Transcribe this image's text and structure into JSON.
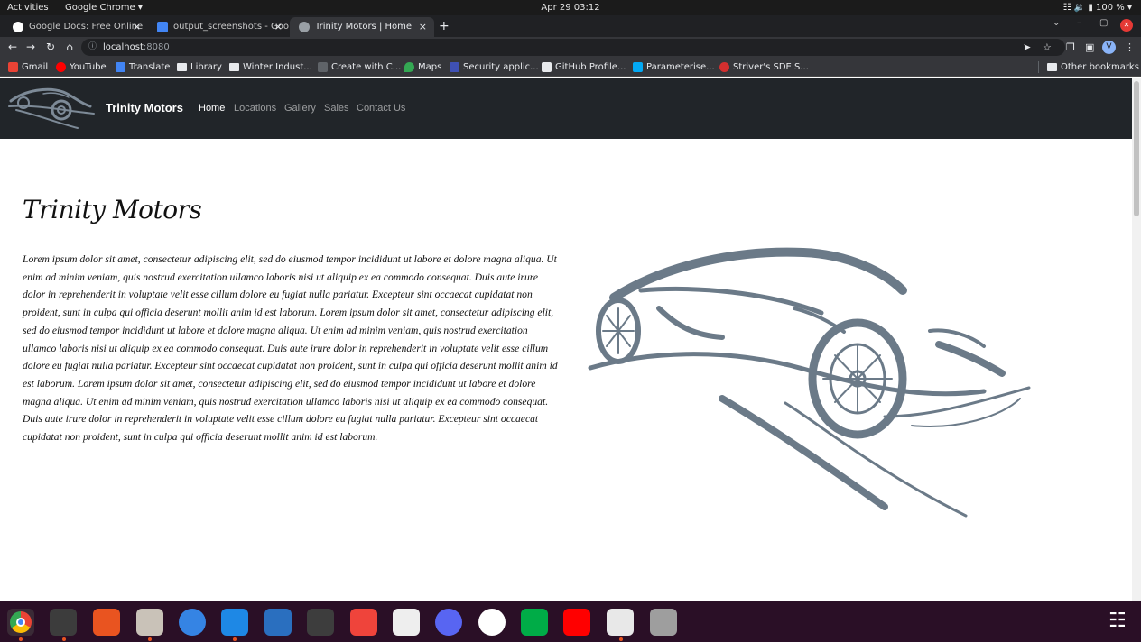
{
  "system_bar": {
    "activities": "Activities",
    "app_menu": "Google Chrome ▾",
    "clock": "Apr 29  03:12",
    "status": "☷ 🔉 ▮ 100 % ▾"
  },
  "browser": {
    "tabs": [
      {
        "label": "Google Docs: Free Online",
        "close": "×"
      },
      {
        "label": "output_screenshots - Goo",
        "close": "×"
      },
      {
        "label": "Trinity Motors | Home",
        "close": "×"
      }
    ],
    "new_tab": "+",
    "window_controls": {
      "menu": "⌄",
      "minimize": "–",
      "restore": "▢",
      "close": "✕"
    },
    "nav": {
      "back": "←",
      "forward": "→",
      "reload": "↻",
      "home": "⌂"
    },
    "url": {
      "host": "localhost",
      "port": ":8080",
      "info_icon": "ⓘ"
    },
    "toolbar_right": {
      "send": "➤",
      "star": "☆",
      "extensions": "❒",
      "sidebar": "▣",
      "profile_initial": "V",
      "menu": "⋮"
    },
    "bookmarks": [
      {
        "label": "Gmail",
        "color": "#ea4335"
      },
      {
        "label": "YouTube",
        "color": "#ff0000"
      },
      {
        "label": "Translate",
        "color": "#4285f4"
      },
      {
        "label": "Library",
        "color": "folder"
      },
      {
        "label": "Winter Indust...",
        "color": "folder"
      },
      {
        "label": "Create with C...",
        "color": "#5f6368"
      },
      {
        "label": "Maps",
        "color": "#34a853"
      },
      {
        "label": "Security applic...",
        "color": "#3f51b5"
      },
      {
        "label": "GitHub Profile...",
        "color": "#e8eaed"
      },
      {
        "label": "Parameterise...",
        "color": "#03a9f4"
      },
      {
        "label": "Striver's SDE S...",
        "color": "#d32f2f"
      }
    ],
    "other_bookmarks": "Other bookmarks"
  },
  "site": {
    "brand": "Trinity Motors",
    "nav": [
      "Home",
      "Locations",
      "Gallery",
      "Sales",
      "Contact Us"
    ],
    "heading": "Trinity Motors",
    "body": "Lorem ipsum dolor sit amet, consectetur adipiscing elit, sed do eiusmod tempor incididunt ut labore et dolore magna aliqua. Ut enim ad minim veniam, quis nostrud exercitation ullamco laboris nisi ut aliquip ex ea commodo consequat. Duis aute irure dolor in reprehenderit in voluptate velit esse cillum dolore eu fugiat nulla pariatur. Excepteur sint occaecat cupidatat non proident, sunt in culpa qui officia deserunt mollit anim id est laborum. Lorem ipsum dolor sit amet, consectetur adipiscing elit, sed do eiusmod tempor incididunt ut labore et dolore magna aliqua. Ut enim ad minim veniam, quis nostrud exercitation ullamco laboris nisi ut aliquip ex ea commodo consequat. Duis aute irure dolor in reprehenderit in voluptate velit esse cillum dolore eu fugiat nulla pariatur. Excepteur sint occaecat cupidatat non proident, sunt in culpa qui officia deserunt mollit anim id est laborum. Lorem ipsum dolor sit amet, consectetur adipiscing elit, sed do eiusmod tempor incididunt ut labore et dolore magna aliqua. Ut enim ad minim veniam, quis nostrud exercitation ullamco laboris nisi ut aliquip ex ea commodo consequat. Duis aute irure dolor in reprehenderit in voluptate velit esse cillum dolore eu fugiat nulla pariatur. Excepteur sint occaecat cupidatat non proident, sunt in culpa qui officia deserunt mollit anim id est laborum.",
    "car_color": "#6b7a88"
  },
  "dock": [
    {
      "name": "chrome",
      "color": "#4285f4"
    },
    {
      "name": "terminal",
      "color": "#3c3c3c"
    },
    {
      "name": "software-center",
      "color": "#e95420"
    },
    {
      "name": "files",
      "color": "#c9c2b8"
    },
    {
      "name": "help",
      "color": "#3584e4"
    },
    {
      "name": "vscode",
      "color": "#1e88e5"
    },
    {
      "name": "writer",
      "color": "#2a6fbf"
    },
    {
      "name": "system-monitor",
      "color": "#3d3d3d"
    },
    {
      "name": "anydesk",
      "color": "#ef443b"
    },
    {
      "name": "document-viewer",
      "color": "#eeeeee"
    },
    {
      "name": "discord",
      "color": "#5865f2"
    },
    {
      "name": "mongodb-compass",
      "color": "#ffffff"
    },
    {
      "name": "google-chat",
      "color": "#00ac47"
    },
    {
      "name": "youtube",
      "color": "#ff0000"
    },
    {
      "name": "text-editor",
      "color": "#e8e8e8"
    },
    {
      "name": "usb-drive",
      "color": "#9e9e9e"
    }
  ],
  "show_apps": "☷"
}
